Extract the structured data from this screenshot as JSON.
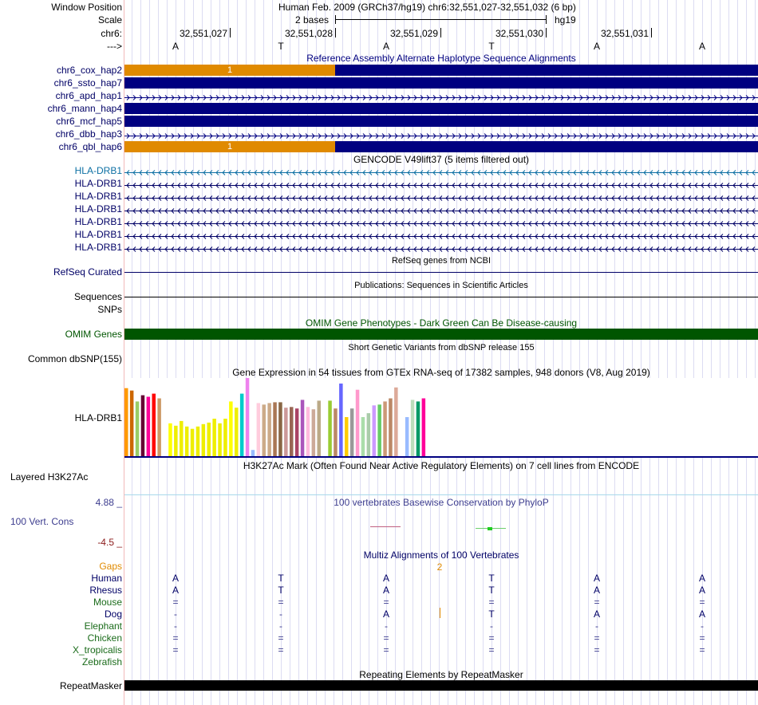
{
  "ruler": {
    "window_position_label": "Window Position",
    "window_position_text": "Human Feb. 2009 (GRCh37/hg19)   chr6:32,551,027-32,551,032 (6 bp)",
    "scale_label": "Scale",
    "scale_text": "2 bases",
    "scale_db": "hg19",
    "chrom_label": "chr6:",
    "positions": [
      "32,551,027",
      "32,551,028",
      "32,551,029",
      "32,551,030",
      "32,551,031"
    ],
    "strand_label": "--->",
    "bases": [
      "A",
      "T",
      "A",
      "T",
      "A",
      "A"
    ]
  },
  "alt_haplotypes": {
    "title": "Reference Assembly Alternate Haplotype Sequence Alignments",
    "rows": [
      {
        "name": "chr6_cox_hap2",
        "style": "orange",
        "mark": "1"
      },
      {
        "name": "chr6_ssto_hap7",
        "style": "solid",
        "mark": ""
      },
      {
        "name": "chr6_apd_hap1",
        "style": "chevron",
        "mark": ""
      },
      {
        "name": "chr6_mann_hap4",
        "style": "solid",
        "mark": ""
      },
      {
        "name": "chr6_mcf_hap5",
        "style": "solid",
        "mark": ""
      },
      {
        "name": "chr6_dbb_hap3",
        "style": "chevron",
        "mark": ""
      },
      {
        "name": "chr6_qbl_hap6",
        "style": "orange",
        "mark": "1"
      }
    ]
  },
  "gencode": {
    "title": "GENCODE V49lift37 (5 items filtered out)",
    "rows": [
      "HLA-DRB1",
      "HLA-DRB1",
      "HLA-DRB1",
      "HLA-DRB1",
      "HLA-DRB1",
      "HLA-DRB1",
      "HLA-DRB1"
    ]
  },
  "refseq": {
    "title": "RefSeq genes from NCBI",
    "label": "RefSeq Curated"
  },
  "publications": {
    "title": "Publications: Sequences in Scientific Articles",
    "label": "Sequences"
  },
  "snps": {
    "label": "SNPs"
  },
  "omim": {
    "title": "OMIM Gene Phenotypes - Dark Green Can Be Disease-causing",
    "label": "OMIM Genes"
  },
  "dbsnp": {
    "title": "Short Genetic Variants from dbSNP release 155",
    "label": "Common dbSNP(155)"
  },
  "gtex": {
    "title": "Gene Expression in 54 tissues from GTEx RNA-seq of 17382 samples, 948 donors (V8, Aug 2019)",
    "label": "HLA-DRB1"
  },
  "chart_data": {
    "type": "bar",
    "title": "",
    "xlabel": "",
    "ylabel": "",
    "ylim": [
      0,
      100
    ],
    "values": [
      87,
      84,
      70,
      78,
      76,
      80,
      74,
      70,
      42,
      39,
      45,
      38,
      35,
      38,
      41,
      43,
      48,
      42,
      48,
      70,
      62,
      80,
      100,
      8,
      68,
      66,
      68,
      69,
      69,
      62,
      63,
      61,
      72,
      63,
      60,
      71,
      70,
      71,
      61,
      93,
      50,
      61,
      85,
      50,
      55,
      65,
      66,
      70,
      74,
      88,
      67,
      50,
      72,
      70,
      74
    ],
    "colors": [
      "#ff9900",
      "#cc6600",
      "#99cc66",
      "#660033",
      "#ff0099",
      "#ff0000",
      "#cc9966",
      "#ffffff",
      "#ffff00",
      "#eeee00",
      "#eeee00",
      "#eeee00",
      "#eeee00",
      "#eeee00",
      "#eeee00",
      "#eeee00",
      "#eeee00",
      "#eeee00",
      "#eeee00",
      "#ffff00",
      "#eeee00",
      "#00cccc",
      "#ee82ee",
      "#99bbff",
      "#ffccdd",
      "#ccaa88",
      "#ccaa88",
      "#aa7755",
      "#886644",
      "#cc9999",
      "#996655",
      "#aa4466",
      "#aa55bb",
      "#ffbbdd",
      "#ccaa99",
      "#bbaa88",
      "#ffffff",
      "#99cc33",
      "#bb8866",
      "#6666ff",
      "#ffcc00",
      "#999999",
      "#ff99cc",
      "#aaddaa",
      "#aaccaa",
      "#cc99ff",
      "#66cc66",
      "#cc9977",
      "#bb8866",
      "#ddaa99",
      "#ffffff",
      "#99bbff",
      "#bbddbb",
      "#009966",
      "#ff0099"
    ]
  },
  "h3k27ac": {
    "title": "H3K27Ac Mark (Often Found Near Active Regulatory Elements) on 7 cell lines from ENCODE",
    "label": "Layered H3K27Ac"
  },
  "phylop": {
    "title": "100 vertebrates Basewise Conservation by PhyloP",
    "label": "100 Vert. Cons",
    "max_label": "4.88 _",
    "min_label": "-4.5 _"
  },
  "multiz": {
    "title": "Multiz Alignments of 100 Vertebrates",
    "gaps_label": "Gaps",
    "gaps_value": "2",
    "species": [
      {
        "name": "Human",
        "color": "#000066",
        "bases": [
          "A",
          "T",
          "A",
          "T",
          "A",
          "A"
        ]
      },
      {
        "name": "Rhesus",
        "color": "#000066",
        "bases": [
          "A",
          "T",
          "A",
          "T",
          "A",
          "A"
        ]
      },
      {
        "name": "Mouse",
        "color": "#1a6b1a",
        "bases": [
          "=",
          "=",
          "=",
          "=",
          "=",
          "="
        ]
      },
      {
        "name": "Dog",
        "color": "#000066",
        "bases": [
          "-",
          "-",
          "A",
          "T",
          "A",
          "A"
        ]
      },
      {
        "name": "Elephant",
        "color": "#1a6b1a",
        "bases": [
          "-",
          "-",
          "-",
          "-",
          "-",
          "-"
        ]
      },
      {
        "name": "Chicken",
        "color": "#1a6b1a",
        "bases": [
          "=",
          "=",
          "=",
          "=",
          "=",
          "="
        ]
      },
      {
        "name": "X_tropicalis",
        "color": "#1a6b1a",
        "bases": [
          "=",
          "=",
          "=",
          "=",
          "=",
          "="
        ]
      },
      {
        "name": "Zebrafish",
        "color": "#1a6b1a",
        "bases": [
          "",
          "",
          "",
          "",
          "",
          ""
        ]
      }
    ]
  },
  "repeatmasker": {
    "title": "Repeating Elements by RepeatMasker",
    "label": "RepeatMasker"
  },
  "colors": {
    "navy": "#000080",
    "orange": "#e08a00",
    "label_blue": "#000066",
    "gencode_teal": "#0c6fa3",
    "omim_green": "#005500",
    "phylop_blue": "#3d3d8f",
    "phylop_red": "#8b1a1a",
    "gaps_orange": "#e08a00"
  }
}
